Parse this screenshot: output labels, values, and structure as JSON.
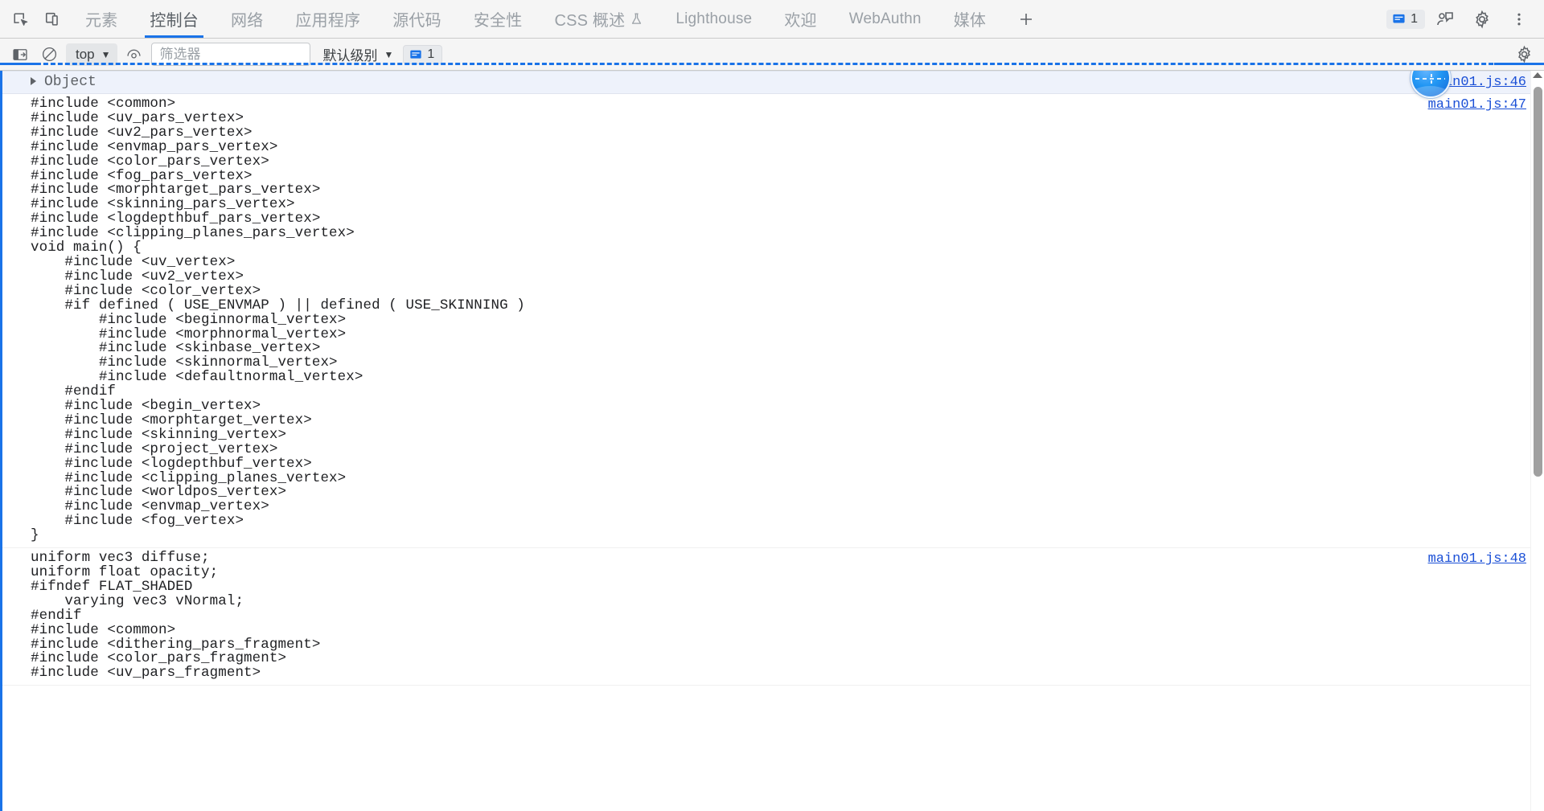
{
  "tabbar": {
    "left_icons": [
      {
        "name": "inspect-element-icon",
        "label": "Inspect element"
      },
      {
        "name": "device-toolbar-icon",
        "label": "Toggle device toolbar"
      }
    ],
    "tabs": [
      {
        "label": "元素",
        "active": false,
        "cjk": true,
        "flask": false
      },
      {
        "label": "控制台",
        "active": true,
        "cjk": true,
        "flask": false
      },
      {
        "label": "网络",
        "active": false,
        "cjk": true,
        "flask": false
      },
      {
        "label": "应用程序",
        "active": false,
        "cjk": true,
        "flask": false
      },
      {
        "label": "源代码",
        "active": false,
        "cjk": true,
        "flask": false
      },
      {
        "label": "安全性",
        "active": false,
        "cjk": true,
        "flask": false
      },
      {
        "label": "CSS 概述",
        "active": false,
        "cjk": true,
        "flask": true
      },
      {
        "label": "Lighthouse",
        "active": false,
        "cjk": false,
        "flask": false
      },
      {
        "label": "欢迎",
        "active": false,
        "cjk": true,
        "flask": false
      },
      {
        "label": "WebAuthn",
        "active": false,
        "cjk": false,
        "flask": false
      },
      {
        "label": "媒体",
        "active": false,
        "cjk": true,
        "flask": false
      }
    ],
    "add_tab_label": "+",
    "message_badge_count": "1",
    "right_icons": [
      {
        "name": "feedback-icon",
        "label": "Feedback"
      },
      {
        "name": "gear-icon",
        "label": "Settings"
      },
      {
        "name": "kebab-menu-icon",
        "label": "Customize and control DevTools"
      }
    ],
    "accent_color": "#1a73e8"
  },
  "console_toolbar": {
    "clear_console_label": "Clear console",
    "no_entry_label": "Console sidebar",
    "context_value": "top",
    "eye_label": "Live expression",
    "filter_placeholder": "筛选器",
    "filter_value": "",
    "level_value": "默认级别",
    "issues_count": "1",
    "settings_label": "Console settings"
  },
  "console": {
    "object_row": {
      "label": "Object",
      "source": "main01.js:46",
      "expanded": false
    },
    "entries": [
      {
        "source": "main01.js:47",
        "code": "#include <common>\n#include <uv_pars_vertex>\n#include <uv2_pars_vertex>\n#include <envmap_pars_vertex>\n#include <color_pars_vertex>\n#include <fog_pars_vertex>\n#include <morphtarget_pars_vertex>\n#include <skinning_pars_vertex>\n#include <logdepthbuf_pars_vertex>\n#include <clipping_planes_pars_vertex>\nvoid main() {\n    #include <uv_vertex>\n    #include <uv2_vertex>\n    #include <color_vertex>\n    #if defined ( USE_ENVMAP ) || defined ( USE_SKINNING )\n        #include <beginnormal_vertex>\n        #include <morphnormal_vertex>\n        #include <skinbase_vertex>\n        #include <skinnormal_vertex>\n        #include <defaultnormal_vertex>\n    #endif\n    #include <begin_vertex>\n    #include <morphtarget_vertex>\n    #include <skinning_vertex>\n    #include <project_vertex>\n    #include <logdepthbuf_vertex>\n    #include <clipping_planes_vertex>\n    #include <worldpos_vertex>\n    #include <envmap_vertex>\n    #include <fog_vertex>\n}"
      },
      {
        "source": "main01.js:48",
        "code": "uniform vec3 diffuse;\nuniform float opacity;\n#ifndef FLAT_SHADED\n    varying vec3 vNormal;\n#endif\n#include <common>\n#include <dithering_pars_fragment>\n#include <color_pars_fragment>\n#include <uv_pars_fragment>"
      }
    ]
  },
  "overlay": {
    "click_indicator_name": "click-highlight"
  }
}
